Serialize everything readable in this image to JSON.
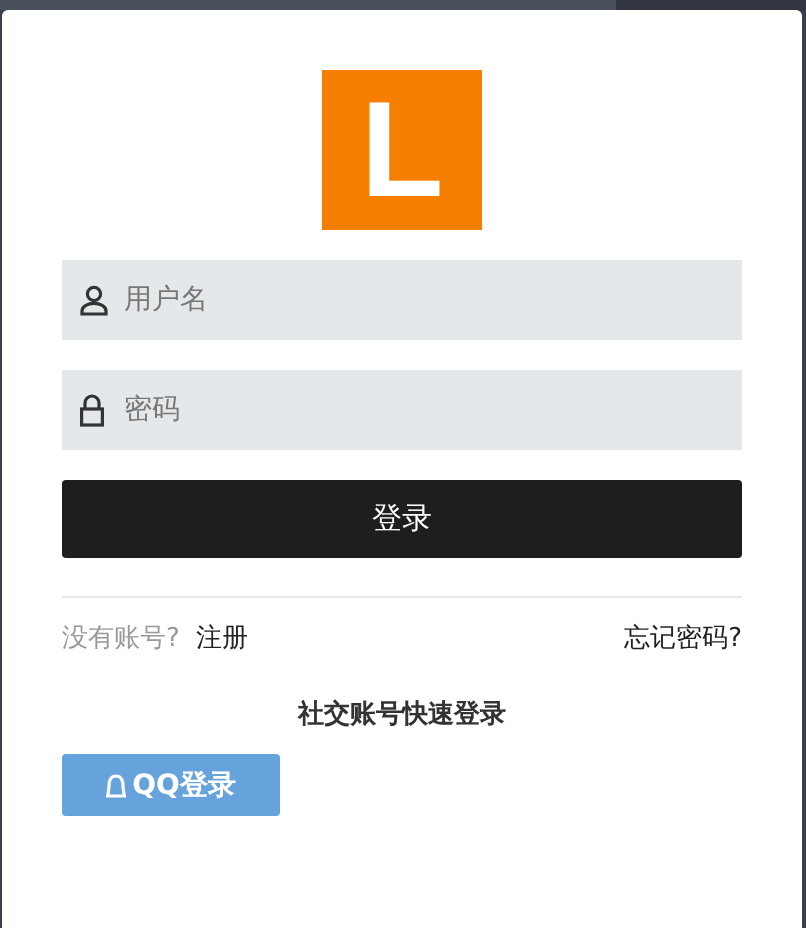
{
  "logo": {
    "letter": "L"
  },
  "fields": [
    {
      "kind": "user",
      "placeholder": "用户名"
    },
    {
      "kind": "lock",
      "placeholder": "密码"
    }
  ],
  "login_button": "登录",
  "links": {
    "prompt": "没有账号?",
    "register": "注册",
    "forgot": "忘记密码?"
  },
  "social": {
    "title": "社交账号快速登录",
    "buttons": [
      {
        "label": "QQ登录"
      }
    ]
  }
}
